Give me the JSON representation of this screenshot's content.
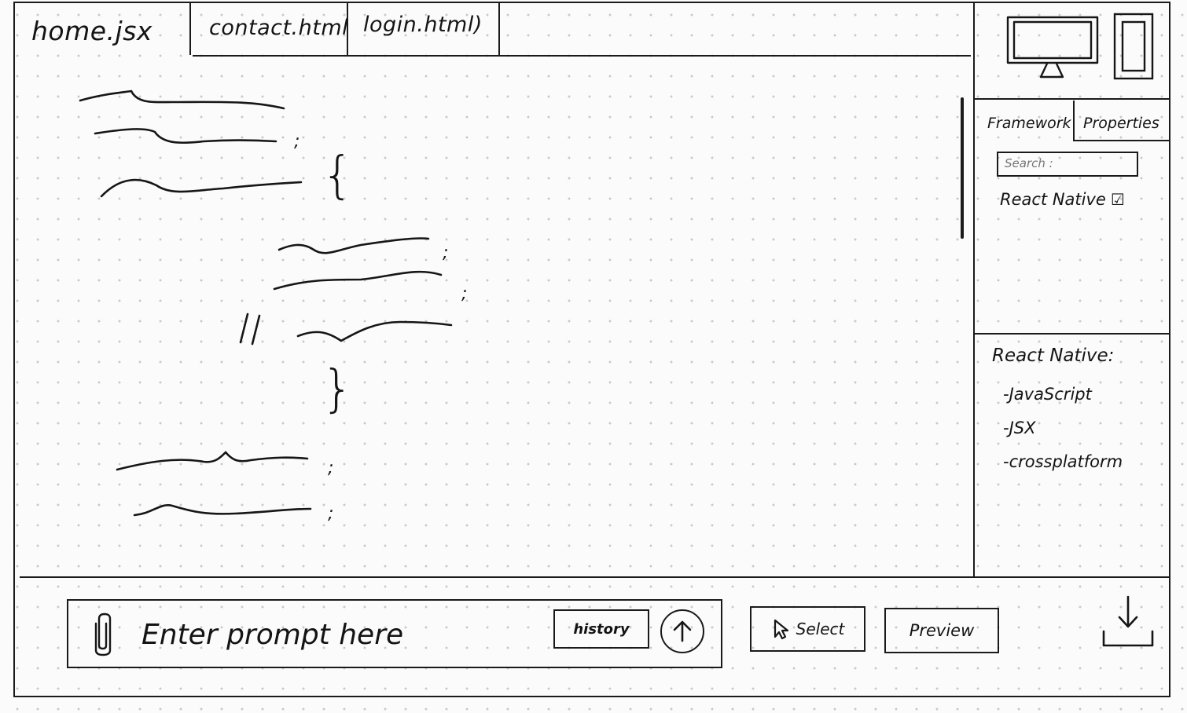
{
  "editor": {
    "tabs": [
      {
        "label": "home.jsx",
        "active": true
      },
      {
        "label": "contact.html"
      },
      {
        "label": "login.html)"
      }
    ],
    "code_punctuation": {
      "semicolon": ";",
      "open_brace": "{",
      "close_brace": "}",
      "comment": "//"
    }
  },
  "panel": {
    "device_icons": [
      "desktop-monitor-icon",
      "mobile-phone-icon"
    ],
    "tabs": [
      {
        "label": "Framework",
        "active": true
      },
      {
        "label": "Properties"
      }
    ],
    "search": {
      "placeholder": "Search :"
    },
    "framework_option": {
      "label": "React Native",
      "checked": true,
      "check_glyph": "☑"
    },
    "properties": {
      "title": "React Native:",
      "items": [
        "-JavaScript",
        "-JSX",
        "-crossplatform"
      ]
    }
  },
  "bottom": {
    "prompt_placeholder": "Enter prompt here",
    "attach_icon": "paperclip-icon",
    "history_label": "history",
    "send_icon": "arrow-up-icon",
    "select_label": "Select",
    "select_icon": "cursor-icon",
    "preview_label": "Preview",
    "download_icon": "download-icon"
  }
}
